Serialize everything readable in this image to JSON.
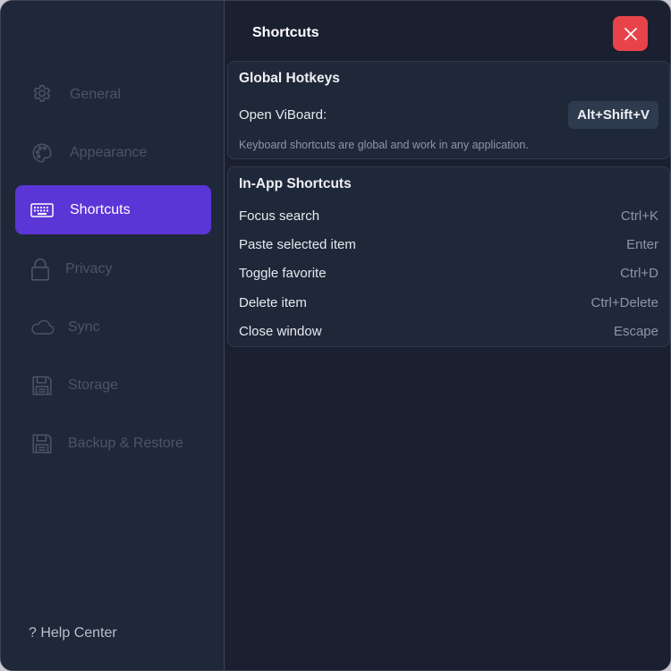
{
  "sidebar": {
    "items": [
      {
        "label": "General",
        "icon": "gear-icon"
      },
      {
        "label": "Appearance",
        "icon": "palette-icon"
      },
      {
        "label": "Shortcuts",
        "icon": "keyboard-icon"
      },
      {
        "label": "Privacy",
        "icon": "lock-icon"
      },
      {
        "label": "Sync",
        "icon": "cloud-icon"
      },
      {
        "label": "Storage",
        "icon": "floppy-disk-icon"
      },
      {
        "label": "Backup & Restore",
        "icon": "floppy-disk-icon"
      }
    ],
    "active": "Shortcuts",
    "help_label": "? Help Center"
  },
  "main": {
    "title": "Shortcuts",
    "close_icon": "close-icon",
    "global": {
      "title": "Global Hotkeys",
      "row_label": "Open ViBoard:",
      "hotkey": "Alt+Shift+V",
      "note": "Keyboard shortcuts are global and work in any application."
    },
    "inapp": {
      "title": "In-App Shortcuts",
      "rows": [
        {
          "label": "Focus search",
          "keys": "Ctrl+K"
        },
        {
          "label": "Paste selected item",
          "keys": "Enter"
        },
        {
          "label": "Toggle favorite",
          "keys": "Ctrl+D"
        },
        {
          "label": "Delete item",
          "keys": "Ctrl+Delete"
        },
        {
          "label": "Close window",
          "keys": "Escape"
        }
      ]
    }
  },
  "colors": {
    "accent": "#5b35d5",
    "close": "#e8434a",
    "background": "#1a2030",
    "sidebar": "#1f2838"
  }
}
